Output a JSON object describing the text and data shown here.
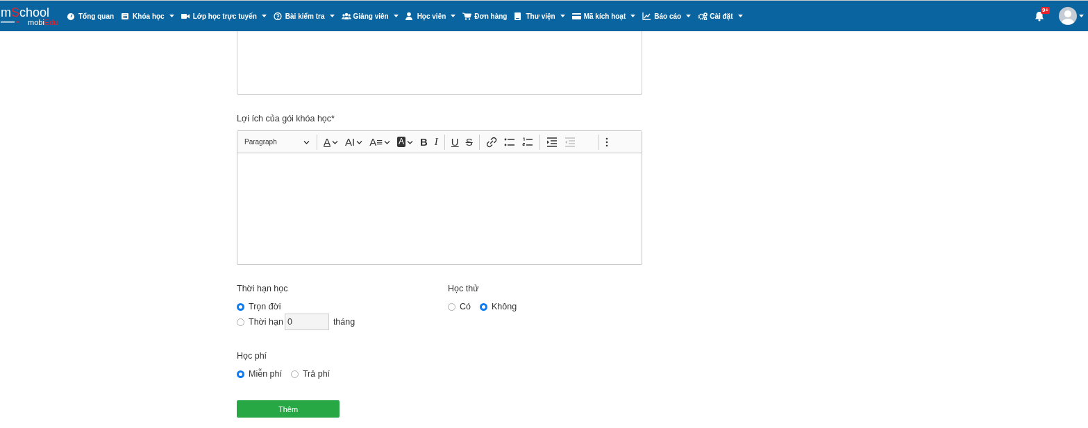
{
  "navbar": {
    "logo": {
      "main": [
        {
          "text": "m",
          "color": "#ffffff"
        },
        {
          "text": "S",
          "color": "#e8232a"
        },
        {
          "text": "chool",
          "color": "#ffffff"
        }
      ],
      "sub": [
        {
          "text": "mobi",
          "color": "#ffffff"
        },
        {
          "text": "Edu",
          "color": "#e8232a"
        }
      ]
    },
    "items": [
      {
        "label": "Tổng quan",
        "dropdown": false
      },
      {
        "label": "Khóa học",
        "dropdown": true
      },
      {
        "label": "Lớp học trực tuyến",
        "dropdown": true
      },
      {
        "label": "Bài kiểm tra",
        "dropdown": true
      },
      {
        "label": "Giảng viên",
        "dropdown": true
      },
      {
        "label": "Học viên",
        "dropdown": true
      },
      {
        "label": "Đơn hàng",
        "dropdown": false
      },
      {
        "label": "Thư viện",
        "dropdown": true
      },
      {
        "label": "Mã kích hoạt",
        "dropdown": true
      },
      {
        "label": "Báo cáo",
        "dropdown": true
      },
      {
        "label": "Cài đặt",
        "dropdown": true
      }
    ],
    "notification_badge": "9+"
  },
  "form": {
    "benefits_label": "Lợi ích của gói khóa học*",
    "toolbar": [
      {
        "kind": "select",
        "text": "Paragraph"
      },
      {
        "kind": "sep"
      },
      {
        "kind": "fontcolor",
        "text": "A"
      },
      {
        "kind": "fontsize",
        "text": "AI"
      },
      {
        "kind": "fontfamily",
        "text": "A≡"
      },
      {
        "kind": "highlight",
        "text": "A"
      },
      {
        "kind": "bold",
        "text": "B"
      },
      {
        "kind": "italic",
        "text": "I"
      },
      {
        "kind": "sep"
      },
      {
        "kind": "underline",
        "text": "U"
      },
      {
        "kind": "strike",
        "text": "S"
      },
      {
        "kind": "sep"
      },
      {
        "kind": "link"
      },
      {
        "kind": "bullets"
      },
      {
        "kind": "numbers"
      },
      {
        "kind": "sep"
      },
      {
        "kind": "indent",
        "disabled": false
      },
      {
        "kind": "outdent",
        "disabled": true
      },
      {
        "kind": "spacer"
      },
      {
        "kind": "sep"
      },
      {
        "kind": "more"
      }
    ],
    "duration": {
      "label": "Thời hạn học",
      "options": [
        {
          "label": "Trọn đời",
          "selected": true
        },
        {
          "label": "Thời hạn",
          "selected": false,
          "input_value": "0",
          "unit": "tháng"
        }
      ]
    },
    "trial": {
      "label": "Học thử",
      "options": [
        {
          "label": "Có",
          "selected": false
        },
        {
          "label": "Không",
          "selected": true
        }
      ]
    },
    "fee": {
      "label": "Học phí",
      "options": [
        {
          "label": "Miễn phí",
          "selected": true
        },
        {
          "label": "Trả phí",
          "selected": false
        }
      ]
    },
    "submit": "Thêm"
  }
}
